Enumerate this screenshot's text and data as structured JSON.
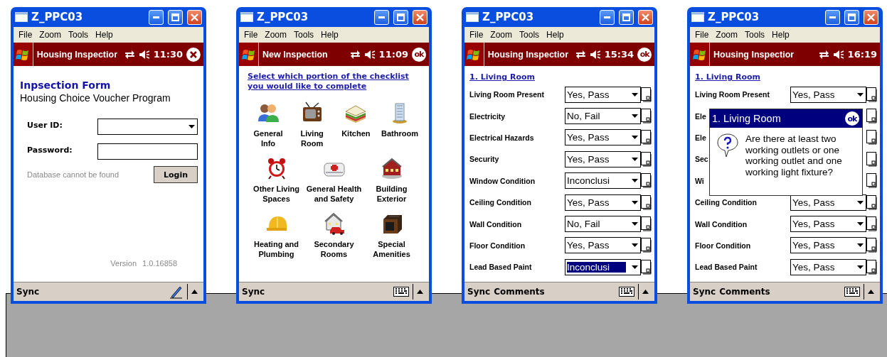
{
  "windows": [
    {
      "title": "Z_PPC03",
      "menu": [
        "File",
        "Zoom",
        "Tools",
        "Help"
      ],
      "header": {
        "title": "Housing Inspectior",
        "time": "11:30",
        "button": {
          "kind": "close"
        }
      },
      "content": {
        "kind": "login",
        "heading": "Inpsection Form",
        "subtitle": "Housing Choice Voucher Program",
        "fields": [
          {
            "label": "User ID:",
            "kind": "dropdown"
          },
          {
            "label": "Password:",
            "kind": "password"
          }
        ],
        "status": "Database cannot be found",
        "button": "Login",
        "version_label": "Version",
        "version": "1.0.16858"
      },
      "bottom_bar": {
        "kind": "pen",
        "items": [
          "Sync"
        ]
      }
    },
    {
      "title": "Z_PPC03",
      "menu": [
        "File",
        "Zoom",
        "Tools",
        "Help"
      ],
      "header": {
        "title": "New Inspection",
        "time": "11:09",
        "button": {
          "kind": "ok",
          "label": "ok"
        }
      },
      "content": {
        "kind": "menu",
        "prompt": "Select which portion of the checklist you would like to complete",
        "rows": [
          [
            {
              "label": "General Info"
            },
            {
              "label": "Living Room"
            },
            {
              "label": "Kitchen"
            },
            {
              "label": "Bathroom"
            }
          ],
          [
            {
              "label": "Other Living Spaces"
            },
            {
              "label": "General Health and Safety"
            },
            {
              "label": "Building Exterior"
            }
          ],
          [
            {
              "label": "Heating and Plumbing"
            },
            {
              "label": "Secondary Rooms"
            },
            {
              "label": "Special Amenities"
            }
          ]
        ]
      },
      "bottom_bar": {
        "kind": "keyboard",
        "items": [
          "Sync"
        ]
      }
    },
    {
      "title": "Z_PPC03",
      "menu": [
        "File",
        "Zoom",
        "Tools",
        "Help"
      ],
      "header": {
        "title": "Housing Inspectior",
        "time": "15:34",
        "button": {
          "kind": "ok",
          "label": "ok"
        }
      },
      "content": {
        "kind": "checklist",
        "section": "1. Living Room",
        "rows": [
          {
            "label": "Living Room Present",
            "value": "Yes, Pass",
            "selected": false
          },
          {
            "label": "Electricity",
            "value": "No, Fail",
            "selected": false
          },
          {
            "label": "Electrical Hazards",
            "value": "Yes, Pass",
            "selected": false
          },
          {
            "label": "Security",
            "value": "Yes, Pass",
            "selected": false
          },
          {
            "label": "Window Condition",
            "value": "Inconclusi",
            "selected": false
          },
          {
            "label": "Ceiling Condition",
            "value": "Yes, Pass",
            "selected": false
          },
          {
            "label": "Wall Condition",
            "value": "No, Fail",
            "selected": false
          },
          {
            "label": "Floor Condition",
            "value": "Yes, Pass",
            "selected": false
          },
          {
            "label": "Lead Based Paint",
            "value": "Inconclusi",
            "selected": true
          }
        ]
      },
      "bottom_bar": {
        "kind": "keyboard",
        "items": [
          "Sync",
          "Comments"
        ]
      }
    },
    {
      "title": "Z_PPC03",
      "menu": [
        "File",
        "Zoom",
        "Tools",
        "Help"
      ],
      "header": {
        "title": "Housing Inspectior",
        "time": "16:19"
      },
      "content": {
        "kind": "checklist",
        "section": "1. Living Room",
        "rows": [
          {
            "label": "Living Room Present",
            "value": "Yes, Pass",
            "selected": false
          },
          {
            "label": "Ele"
          },
          {
            "label": "Ele"
          },
          {
            "label": "Sec"
          },
          {
            "label": "Wi"
          },
          {
            "label": "Ceiling Condition",
            "value": "Yes, Pass",
            "selected": false
          },
          {
            "label": "Wall Condition",
            "value": "Yes, Pass",
            "selected": false
          },
          {
            "label": "Floor Condition",
            "value": "Yes, Pass",
            "selected": false
          },
          {
            "label": "Lead Based Paint",
            "value": "Yes, Pass",
            "selected": false
          }
        ],
        "dialog": {
          "title": "1. Living Room",
          "ok_label": "ok",
          "message": "Are there at least two working outlets or one working outlet and one working light fixture?"
        }
      },
      "bottom_bar": {
        "kind": "keyboard",
        "items": [
          "Sync",
          "Comments"
        ]
      }
    }
  ]
}
